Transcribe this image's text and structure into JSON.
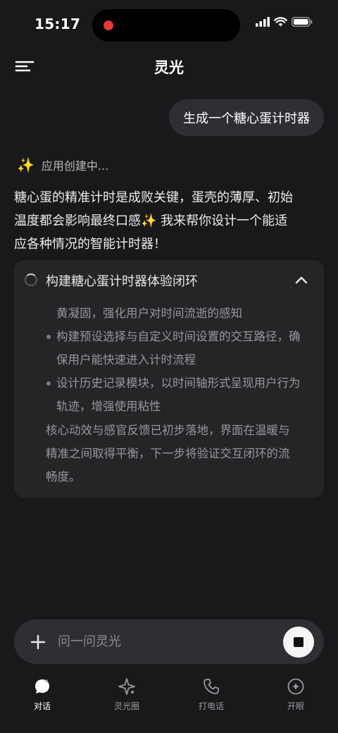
{
  "status_bar": {
    "time": "15:17"
  },
  "header": {
    "title": "灵光"
  },
  "user_message": "生成一个糖心蛋计时器",
  "assistant": {
    "status": "应用创建中...",
    "reply_lines": [
      "糖心蛋的精准计时是成败关键，蛋壳的薄厚、初始",
      "温度都会影响最终口感",
      " 我来帮你设计一个能适",
      "应各种情况的智能计时器！"
    ],
    "reply_emoji": "✨",
    "thinking": {
      "title": "构建糖心蛋计时器体验闭环",
      "lines": [
        "黄凝固，强化用户对时间流逝的感知",
        "构建预设选择与自定义时间设置的交互路径，确",
        "保用户能快速进入计时流程",
        "设计历史记录模块，以时间轴形式呈现用户行为",
        "轨迹，增强使用粘性"
      ],
      "summary_lines": [
        "核心动效与感官反馈已初步落地，界面在温暖与",
        "精准之间取得平衡，下一步将验证交互闭环的流",
        "畅度。"
      ]
    }
  },
  "composer": {
    "placeholder": "问一问灵光"
  },
  "tabs": [
    {
      "label": "对话",
      "icon": "chat-bubble-icon",
      "active": true
    },
    {
      "label": "灵光圈",
      "icon": "sparkle-star-icon",
      "active": false
    },
    {
      "label": "打电话",
      "icon": "phone-icon",
      "active": false
    },
    {
      "label": "开眼",
      "icon": "eye-icon",
      "active": false
    }
  ]
}
